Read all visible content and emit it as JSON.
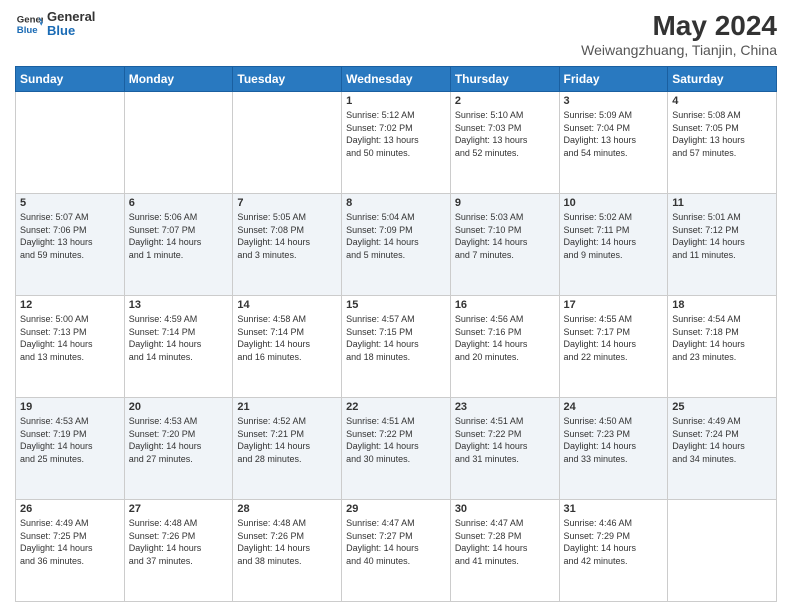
{
  "header": {
    "logo_line1": "General",
    "logo_line2": "Blue",
    "main_title": "May 2024",
    "subtitle": "Weiwangzhuang, Tianjin, China"
  },
  "days_of_week": [
    "Sunday",
    "Monday",
    "Tuesday",
    "Wednesday",
    "Thursday",
    "Friday",
    "Saturday"
  ],
  "weeks": [
    [
      {
        "day": "",
        "content": ""
      },
      {
        "day": "",
        "content": ""
      },
      {
        "day": "",
        "content": ""
      },
      {
        "day": "1",
        "content": "Sunrise: 5:12 AM\nSunset: 7:02 PM\nDaylight: 13 hours\nand 50 minutes."
      },
      {
        "day": "2",
        "content": "Sunrise: 5:10 AM\nSunset: 7:03 PM\nDaylight: 13 hours\nand 52 minutes."
      },
      {
        "day": "3",
        "content": "Sunrise: 5:09 AM\nSunset: 7:04 PM\nDaylight: 13 hours\nand 54 minutes."
      },
      {
        "day": "4",
        "content": "Sunrise: 5:08 AM\nSunset: 7:05 PM\nDaylight: 13 hours\nand 57 minutes."
      }
    ],
    [
      {
        "day": "5",
        "content": "Sunrise: 5:07 AM\nSunset: 7:06 PM\nDaylight: 13 hours\nand 59 minutes."
      },
      {
        "day": "6",
        "content": "Sunrise: 5:06 AM\nSunset: 7:07 PM\nDaylight: 14 hours\nand 1 minute."
      },
      {
        "day": "7",
        "content": "Sunrise: 5:05 AM\nSunset: 7:08 PM\nDaylight: 14 hours\nand 3 minutes."
      },
      {
        "day": "8",
        "content": "Sunrise: 5:04 AM\nSunset: 7:09 PM\nDaylight: 14 hours\nand 5 minutes."
      },
      {
        "day": "9",
        "content": "Sunrise: 5:03 AM\nSunset: 7:10 PM\nDaylight: 14 hours\nand 7 minutes."
      },
      {
        "day": "10",
        "content": "Sunrise: 5:02 AM\nSunset: 7:11 PM\nDaylight: 14 hours\nand 9 minutes."
      },
      {
        "day": "11",
        "content": "Sunrise: 5:01 AM\nSunset: 7:12 PM\nDaylight: 14 hours\nand 11 minutes."
      }
    ],
    [
      {
        "day": "12",
        "content": "Sunrise: 5:00 AM\nSunset: 7:13 PM\nDaylight: 14 hours\nand 13 minutes."
      },
      {
        "day": "13",
        "content": "Sunrise: 4:59 AM\nSunset: 7:14 PM\nDaylight: 14 hours\nand 14 minutes."
      },
      {
        "day": "14",
        "content": "Sunrise: 4:58 AM\nSunset: 7:14 PM\nDaylight: 14 hours\nand 16 minutes."
      },
      {
        "day": "15",
        "content": "Sunrise: 4:57 AM\nSunset: 7:15 PM\nDaylight: 14 hours\nand 18 minutes."
      },
      {
        "day": "16",
        "content": "Sunrise: 4:56 AM\nSunset: 7:16 PM\nDaylight: 14 hours\nand 20 minutes."
      },
      {
        "day": "17",
        "content": "Sunrise: 4:55 AM\nSunset: 7:17 PM\nDaylight: 14 hours\nand 22 minutes."
      },
      {
        "day": "18",
        "content": "Sunrise: 4:54 AM\nSunset: 7:18 PM\nDaylight: 14 hours\nand 23 minutes."
      }
    ],
    [
      {
        "day": "19",
        "content": "Sunrise: 4:53 AM\nSunset: 7:19 PM\nDaylight: 14 hours\nand 25 minutes."
      },
      {
        "day": "20",
        "content": "Sunrise: 4:53 AM\nSunset: 7:20 PM\nDaylight: 14 hours\nand 27 minutes."
      },
      {
        "day": "21",
        "content": "Sunrise: 4:52 AM\nSunset: 7:21 PM\nDaylight: 14 hours\nand 28 minutes."
      },
      {
        "day": "22",
        "content": "Sunrise: 4:51 AM\nSunset: 7:22 PM\nDaylight: 14 hours\nand 30 minutes."
      },
      {
        "day": "23",
        "content": "Sunrise: 4:51 AM\nSunset: 7:22 PM\nDaylight: 14 hours\nand 31 minutes."
      },
      {
        "day": "24",
        "content": "Sunrise: 4:50 AM\nSunset: 7:23 PM\nDaylight: 14 hours\nand 33 minutes."
      },
      {
        "day": "25",
        "content": "Sunrise: 4:49 AM\nSunset: 7:24 PM\nDaylight: 14 hours\nand 34 minutes."
      }
    ],
    [
      {
        "day": "26",
        "content": "Sunrise: 4:49 AM\nSunset: 7:25 PM\nDaylight: 14 hours\nand 36 minutes."
      },
      {
        "day": "27",
        "content": "Sunrise: 4:48 AM\nSunset: 7:26 PM\nDaylight: 14 hours\nand 37 minutes."
      },
      {
        "day": "28",
        "content": "Sunrise: 4:48 AM\nSunset: 7:26 PM\nDaylight: 14 hours\nand 38 minutes."
      },
      {
        "day": "29",
        "content": "Sunrise: 4:47 AM\nSunset: 7:27 PM\nDaylight: 14 hours\nand 40 minutes."
      },
      {
        "day": "30",
        "content": "Sunrise: 4:47 AM\nSunset: 7:28 PM\nDaylight: 14 hours\nand 41 minutes."
      },
      {
        "day": "31",
        "content": "Sunrise: 4:46 AM\nSunset: 7:29 PM\nDaylight: 14 hours\nand 42 minutes."
      },
      {
        "day": "",
        "content": ""
      }
    ]
  ]
}
